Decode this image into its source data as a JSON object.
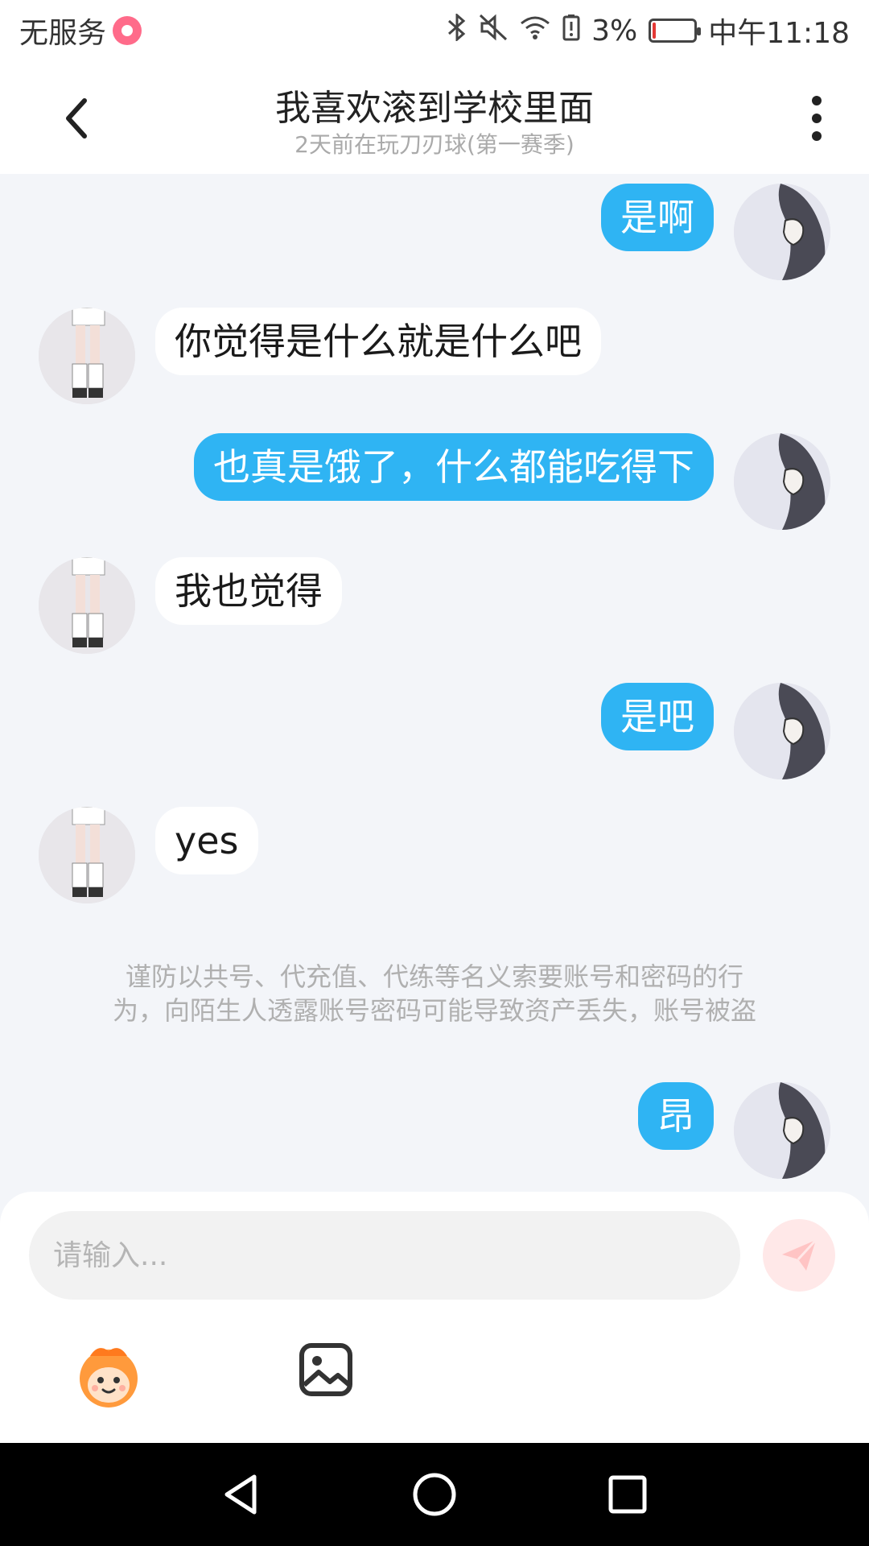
{
  "status_bar": {
    "carrier": "无服务",
    "battery_percent": "3%",
    "battery_level": 0.03,
    "time": "中午11:18"
  },
  "header": {
    "title": "我喜欢滚到学校里面",
    "subtitle": "2天前在玩刀刃球(第一赛季)"
  },
  "messages": [
    {
      "side": "self",
      "text": "是啊"
    },
    {
      "side": "other",
      "text": "你觉得是什么就是什么吧"
    },
    {
      "side": "self",
      "text": "也真是饿了，什么都能吃得下"
    },
    {
      "side": "other",
      "text": "我也觉得"
    },
    {
      "side": "self",
      "text": "是吧"
    },
    {
      "side": "other",
      "text": "yes"
    },
    {
      "side": "self",
      "text": "昂"
    }
  ],
  "notice": {
    "line1": "谨防以共号、代充值、代练等名义索要账号和密码的行",
    "line2": "为，向陌生人透露账号密码可能导致资产丢失，账号被盗"
  },
  "input": {
    "placeholder": "请输入..."
  },
  "colors": {
    "accent": "#2fb4f3",
    "background": "#f3f5f9",
    "send_button": "#ffe8e8"
  },
  "icons": {
    "back": "chevron-left-icon",
    "more": "more-vertical-icon",
    "send": "send-icon",
    "emoji": "mascot-face-icon",
    "image": "image-icon",
    "nav_back": "triangle-back-icon",
    "nav_home": "circle-home-icon",
    "nav_recent": "square-recent-icon"
  }
}
